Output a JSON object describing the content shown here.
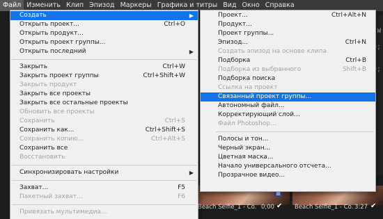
{
  "menubar": {
    "items": [
      "Файл",
      "Изменить",
      "Клип",
      "Эпизод",
      "Маркеры",
      "Графика и титры",
      "Вид",
      "Окно",
      "Справка"
    ]
  },
  "file_menu": {
    "items": [
      {
        "label": "Создать",
        "shortcut": "",
        "submenu": true,
        "state": "highlighted"
      },
      {
        "label": "Открыть проект...",
        "shortcut": "Ctrl+O"
      },
      {
        "label": "Открыть продукт...",
        "shortcut": ""
      },
      {
        "label": "Открыть проект группы...",
        "shortcut": ""
      },
      {
        "label": "Открыть последний",
        "shortcut": "",
        "submenu": true
      },
      {
        "label": "Закрыть",
        "shortcut": "Ctrl+W"
      },
      {
        "label": "Закрыть проект группы",
        "shortcut": "Ctrl+Shift+W"
      },
      {
        "label": "Закрыть продукт",
        "shortcut": "",
        "state": "disabled"
      },
      {
        "label": "Закрыть все проекты",
        "shortcut": ""
      },
      {
        "label": "Закрыть все остальные проекты",
        "shortcut": ""
      },
      {
        "label": "Обновить все проекты",
        "shortcut": "",
        "state": "disabled"
      },
      {
        "label": "Сохранить",
        "shortcut": "Ctrl+S",
        "state": "disabled"
      },
      {
        "label": "Сохранить как...",
        "shortcut": "Ctrl+Shift+S"
      },
      {
        "label": "Сохранить копию...",
        "shortcut": "Ctrl+Alt+S",
        "state": "disabled"
      },
      {
        "label": "Сохранить все",
        "shortcut": ""
      },
      {
        "label": "Восстановить",
        "shortcut": "",
        "state": "disabled"
      },
      {
        "label": "Синхронизировать настройки",
        "shortcut": "",
        "submenu": true
      },
      {
        "label": "Захват...",
        "shortcut": "F5"
      },
      {
        "label": "Пакетный захват...",
        "shortcut": "F6",
        "state": "disabled"
      },
      {
        "label": "Привязать мультимедиа...",
        "shortcut": "",
        "state": "disabled"
      }
    ]
  },
  "create_menu": {
    "items": [
      {
        "label": "Проект...",
        "shortcut": "Ctrl+Alt+N"
      },
      {
        "label": "Продукт...",
        "shortcut": ""
      },
      {
        "label": "Проект группы...",
        "shortcut": ""
      },
      {
        "label": "Эпизод...",
        "shortcut": "Ctrl+N"
      },
      {
        "label": "Создать эпизод на основе клипа",
        "shortcut": "",
        "state": "disabled"
      },
      {
        "label": "Подборка",
        "shortcut": "Ctrl+B"
      },
      {
        "label": "Подборка из выбранного",
        "shortcut": "Shift+B",
        "state": "disabled"
      },
      {
        "label": "Подборка поиска",
        "shortcut": ""
      },
      {
        "label": "Ссылка на проект",
        "shortcut": "",
        "state": "disabled"
      },
      {
        "label": "Связанный проект группы...",
        "shortcut": "",
        "state": "highlighted"
      },
      {
        "label": "Автономный файл...",
        "shortcut": ""
      },
      {
        "label": "Корректирующий слой...",
        "shortcut": ""
      },
      {
        "label": "Файл Photoshop...",
        "shortcut": "",
        "state": "disabled"
      },
      {
        "label": "Полосы и тон...",
        "shortcut": ""
      },
      {
        "label": "Черный экран...",
        "shortcut": ""
      },
      {
        "label": "Цветная маска...",
        "shortcut": ""
      },
      {
        "label": "Начало универсального отсчета...",
        "shortcut": ""
      },
      {
        "label": "Прозрачное видео...",
        "shortcut": ""
      }
    ]
  },
  "background": {
    "clips": [
      {
        "name": "Beach Selfie_1 - Co...",
        "duration": "0;00"
      },
      {
        "name": "Beach Selfie_1 - Co...",
        "duration": "3:27"
      }
    ],
    "side_fragments": [
      "W",
      "0;",
      "0;"
    ]
  },
  "icons": {
    "submenu_arrow": "chevron-right-icon",
    "check": "checkmark-icon"
  },
  "colors": {
    "menu_bg": "#f0f0f0",
    "highlight": "#1473e6",
    "disabled_text": "#a4a4a4",
    "menubar_bg": "#3a3a3a"
  }
}
